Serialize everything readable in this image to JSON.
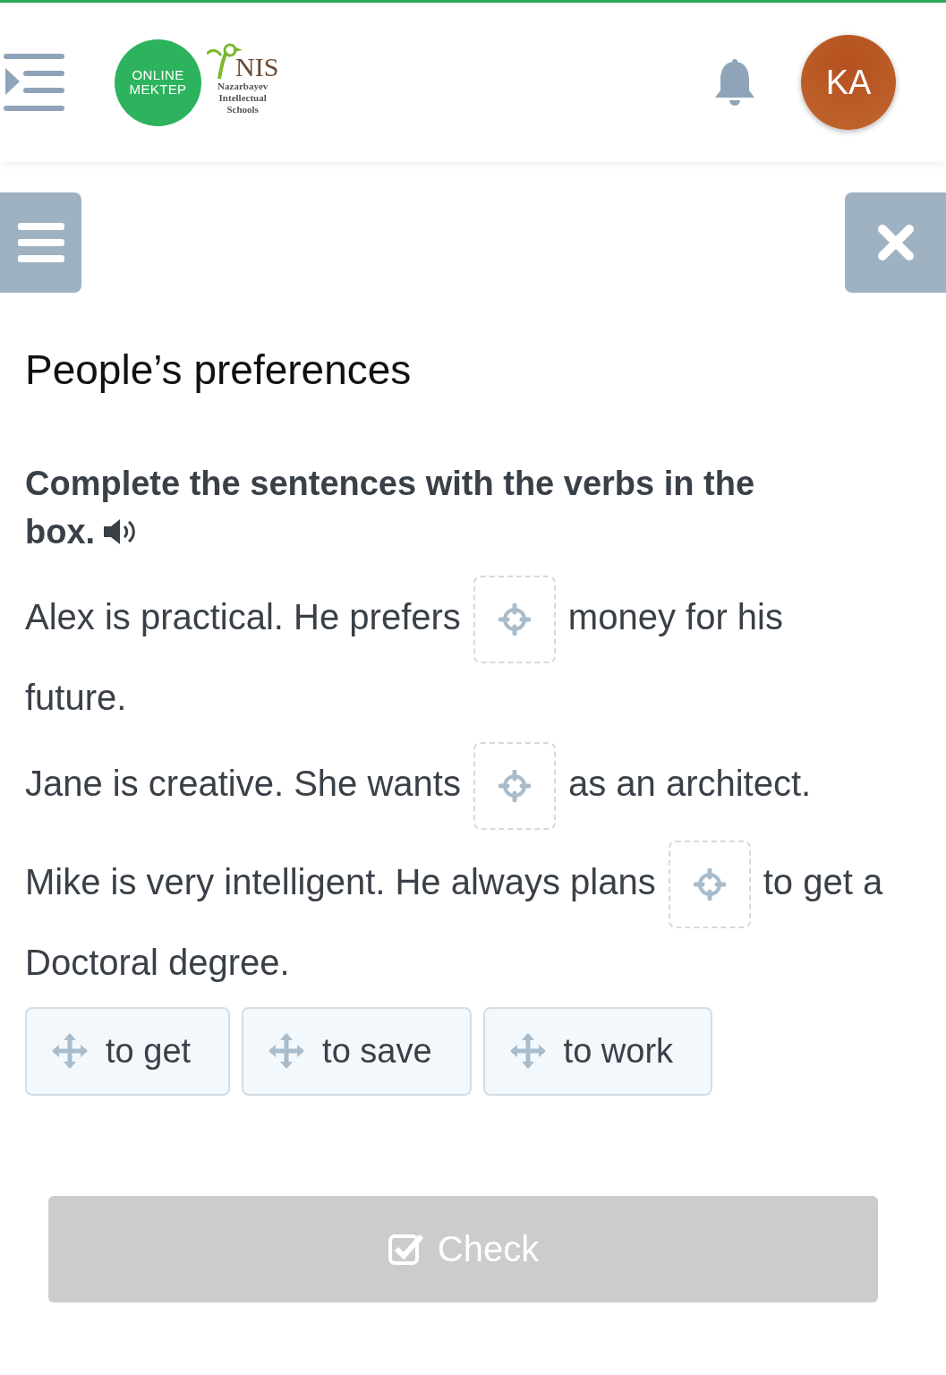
{
  "header": {
    "logo": {
      "line_1": "ONLINE",
      "line_2": "MEKTEP"
    },
    "partner_logo": {
      "title": "NIS",
      "subtitle": "Nazarbayev Intellectual Schools"
    },
    "avatar": "KA"
  },
  "title": "People’s preferences",
  "instruction": {
    "line_1": "Complete the sentences with the verbs in the",
    "line_2": "box."
  },
  "sentences": [
    {
      "before": "Alex is practical. He prefers",
      "after": "money for his",
      "continuation": "future."
    },
    {
      "before": "Jane is creative. She wants",
      "after": "as an architect."
    },
    {
      "before": "Mike is very intelligent. He always plans",
      "after": "to get a",
      "continuation": "Doctoral degree."
    }
  ],
  "options": [
    "to get",
    "to save",
    "to work"
  ],
  "check_button": {
    "label": "Check",
    "disabled": true
  }
}
